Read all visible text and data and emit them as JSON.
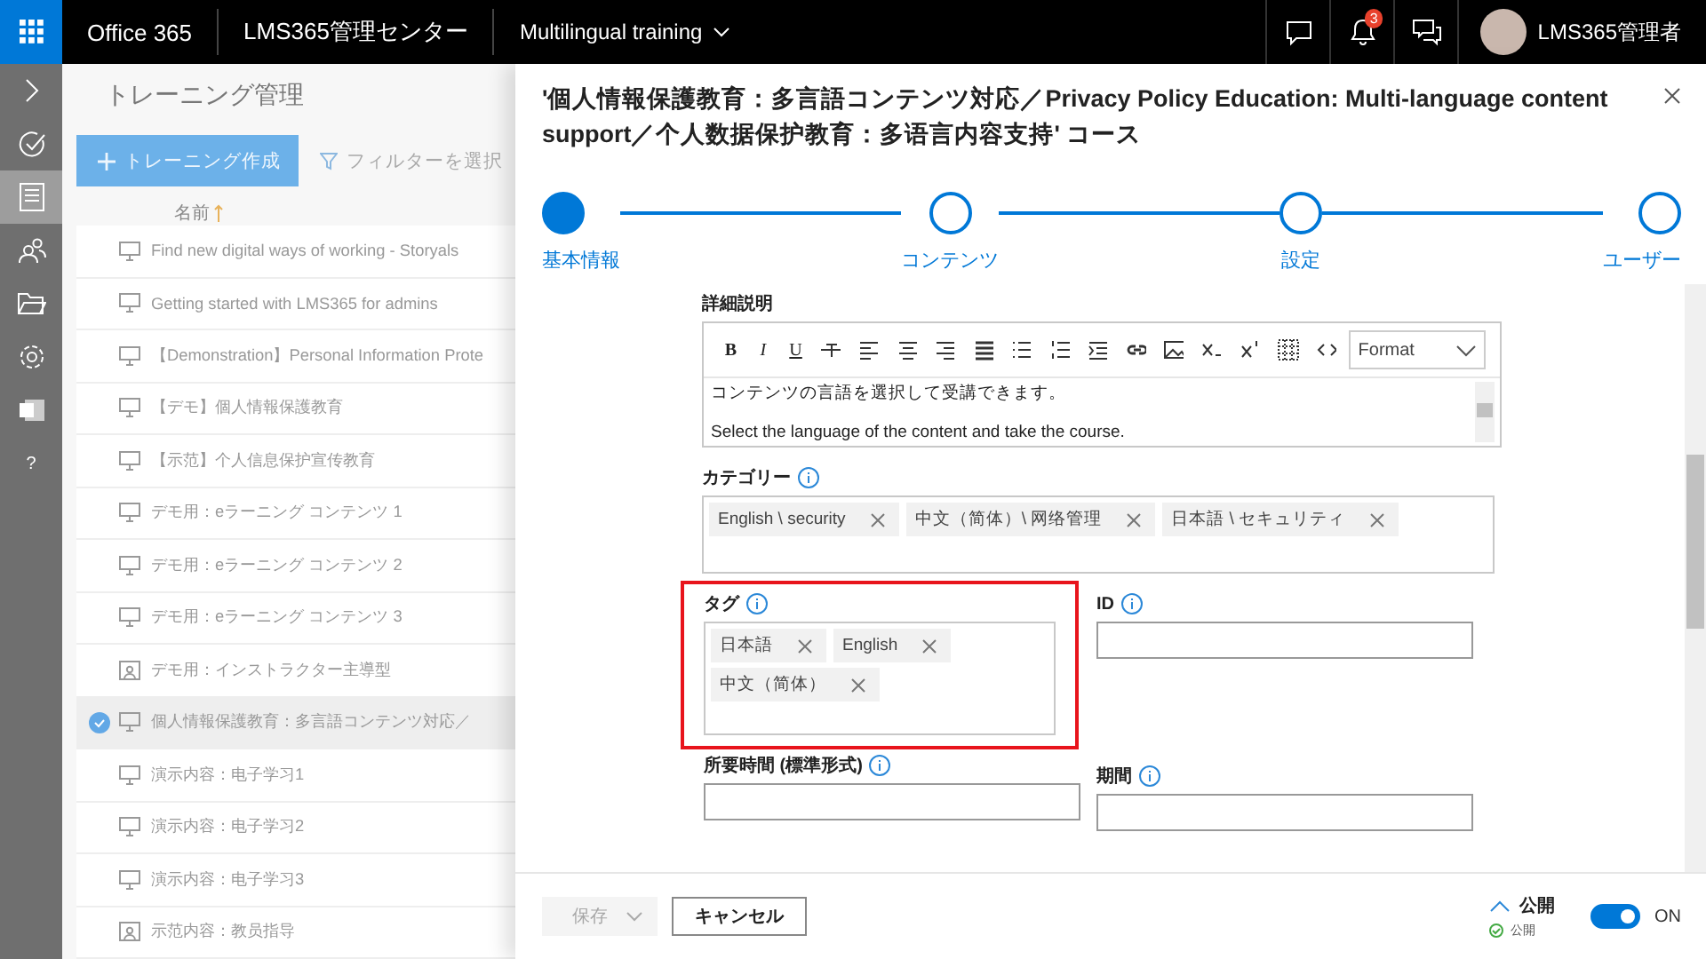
{
  "top_bar": {
    "brand": "Office 365",
    "admin_center": "LMS365管理センター",
    "site": "Multilingual training",
    "notification_count": "3",
    "user_name": "LMS365管理者"
  },
  "nav_rail": [
    {
      "kind": "expand",
      "selected": false
    },
    {
      "kind": "tasks",
      "selected": false
    },
    {
      "kind": "trainings",
      "selected": true
    },
    {
      "kind": "users",
      "selected": false
    },
    {
      "kind": "files",
      "selected": false
    },
    {
      "kind": "settings",
      "selected": false
    },
    {
      "kind": "office",
      "selected": false
    },
    {
      "kind": "help",
      "label": "?",
      "selected": false
    }
  ],
  "training_list": {
    "title": "トレーニング管理",
    "create_button": "トレーニング作成",
    "filter_button": "フィルターを選択",
    "column_header": "名前",
    "rows": [
      {
        "title": "Find new digital ways of working - Storyals",
        "kind": "ecourse",
        "selected": false
      },
      {
        "title": "Getting started with LMS365 for admins",
        "kind": "ecourse",
        "selected": false
      },
      {
        "title": "【Demonstration】Personal Information Prote",
        "kind": "ecourse",
        "selected": false
      },
      {
        "title": "【デモ】個人情報保護教育",
        "kind": "ecourse",
        "selected": false
      },
      {
        "title": "【示范】个人信息保护宣传教育",
        "kind": "ecourse",
        "selected": false
      },
      {
        "title": "デモ用：eラーニング コンテンツ 1",
        "kind": "ecourse",
        "selected": false
      },
      {
        "title": "デモ用：eラーニング コンテンツ 2",
        "kind": "ecourse",
        "selected": false
      },
      {
        "title": "デモ用：eラーニング コンテンツ 3",
        "kind": "ecourse",
        "selected": false
      },
      {
        "title": "デモ用：インストラクター主導型",
        "kind": "classroom",
        "selected": false
      },
      {
        "title": "個人情報保護教育：多言語コンテンツ対応／",
        "kind": "ecourse",
        "selected": true
      },
      {
        "title": "演示内容：电子学习1",
        "kind": "ecourse",
        "selected": false
      },
      {
        "title": "演示内容：电子学习2",
        "kind": "ecourse",
        "selected": false
      },
      {
        "title": "演示内容：电子学习3",
        "kind": "ecourse",
        "selected": false
      },
      {
        "title": "示范内容：教员指导",
        "kind": "classroom",
        "selected": false
      }
    ]
  },
  "panel": {
    "title": "'個人情報保護教育：多言語コンテンツ対応／Privacy Policy Education: Multi-language content support／个人数据保护教育：多语言内容支持' コース",
    "steps": [
      {
        "label": "基本情報",
        "selected": true
      },
      {
        "label": "コンテンツ",
        "selected": false
      },
      {
        "label": "設定",
        "selected": false
      },
      {
        "label": "ユーザー",
        "selected": false
      }
    ],
    "description": {
      "label": "詳細説明",
      "toolbar_text_buttons": [
        "B",
        "I",
        "U"
      ],
      "format_dropdown": "Format",
      "lines": [
        "コンテンツの言語を選択して受講できます。",
        "Select the language of the content and take the course."
      ]
    },
    "category": {
      "label": "カテゴリー",
      "tags": [
        "English \\ security",
        "中文（简体）\\ 网络管理",
        "日本語 \\ セキュリティ"
      ]
    },
    "tags": {
      "label": "タグ",
      "highlighted": true,
      "tags": [
        "日本語",
        "English",
        "中文（简体）"
      ]
    },
    "id_field": {
      "label": "ID"
    },
    "duration_field": {
      "label": "所要時間 (標準形式)"
    },
    "period_field": {
      "label": "期間"
    },
    "footer": {
      "save_button": {
        "label": "保存",
        "disabled": true
      },
      "cancel_button": "キャンセル",
      "publish_label": "公開",
      "publish_status": "公開",
      "toggle": {
        "on": true,
        "label": "ON"
      }
    }
  }
}
